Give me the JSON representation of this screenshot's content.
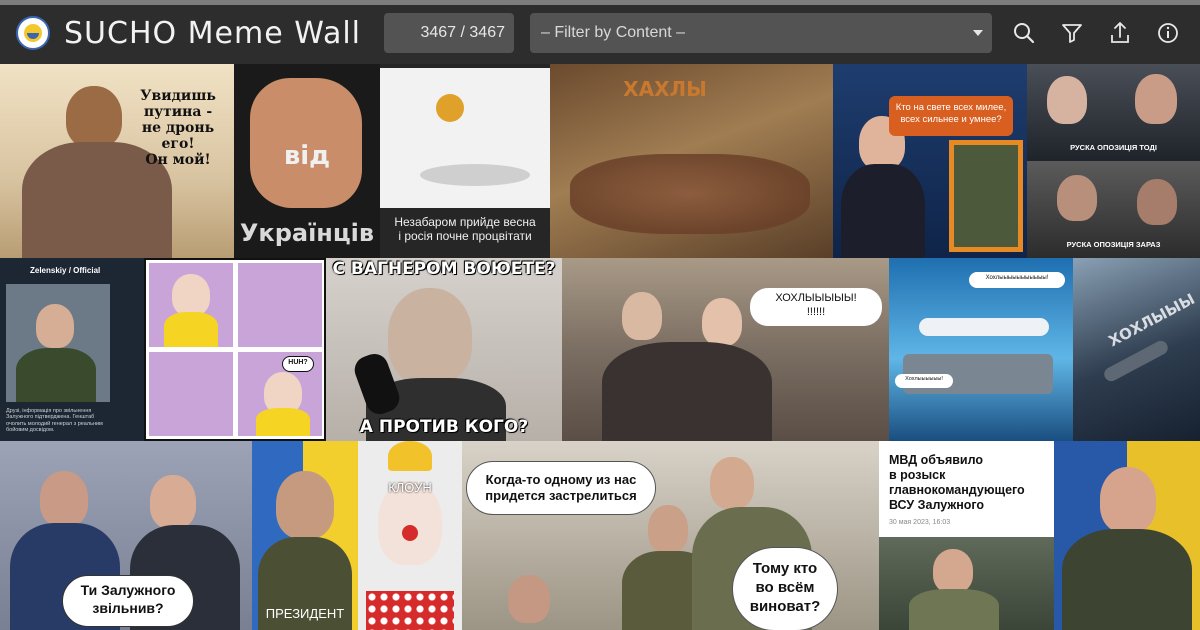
{
  "header": {
    "title": "SUCHO Meme Wall",
    "counter": "3467 / 3467",
    "filter_placeholder": "– Filter by Content –",
    "icons": [
      "search-icon",
      "filter-icon",
      "share-icon",
      "info-icon"
    ]
  },
  "tiles": {
    "t1": "Увидишь\nпутина -\nне дронь его!\nОн мой!",
    "t2_top": "від",
    "t2_bottom": "Українців",
    "t3": "Незабаром прийде весна\nі росія почне процвітати",
    "t4": "ХАХЛЫ",
    "t5": "Кто на свете всех милее,\nвсех сильнее и умнее?",
    "t6_top": "РУСКА ОПОЗИЦІЯ ТОДІ",
    "t6_bottom": "РУСКА ОПОЗИЦІЯ ЗАРАЗ",
    "t7_header": "Zelenskiy / Official",
    "t7_text": "Друзі, інформація про звільнення Залужного підтверджена. Генштаб очолить молодий генерал з реальним бойовим досвідом.",
    "t8_bubble": "HUH?",
    "t9_top": "С ВАГНЕРОМ ВОЮЕТЕ?",
    "t9_bottom": "А ПРОТИВ КОГО?",
    "t10": "ХОХЛЫЫЫЫЫ!\n!!!!!!",
    "t11_top": "Хохлыыыыыыыыыыы!",
    "t11_bottom": "Хохлыыыыыы!",
    "t12": "ХОХЛЫЫЫ",
    "t13": "Ти Залужного\nзвільнив?",
    "t14": "ПРЕЗИДЕНТ",
    "t15": "КЛОУН",
    "t16_top": "Когда-то одному из нас\nпридется застрелиться",
    "t16_bottom": "Тому кто\nво всём\nвиноват?",
    "t17_title": "МВД объявило\nв розыск\nглавнокомандующего\nВСУ Залужного",
    "t17_date": "30 мая 2023, 16:03"
  },
  "colors": {
    "header_bg": "#2d2d2d",
    "field_bg": "#535353",
    "text": "#f2f2f2"
  }
}
